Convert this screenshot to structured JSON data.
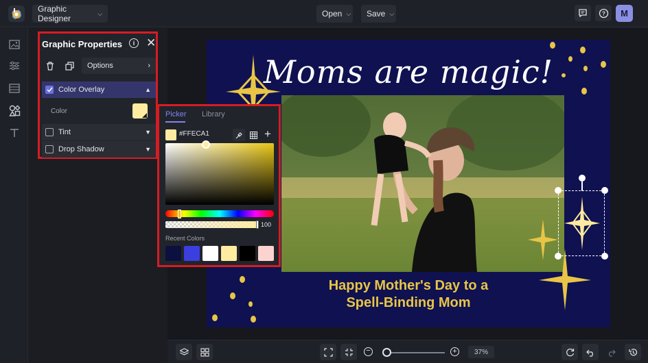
{
  "app": {
    "mode_label": "Graphic Designer",
    "open_label": "Open",
    "save_label": "Save",
    "avatar_initial": "M"
  },
  "properties_panel": {
    "title": "Graphic Properties",
    "options_label": "Options",
    "color_overlay": {
      "label": "Color Overlay",
      "checked": true,
      "color_label": "Color",
      "color_value": "#FFECA1"
    },
    "tint": {
      "label": "Tint",
      "checked": false
    },
    "drop_shadow": {
      "label": "Drop Shadow",
      "checked": false
    }
  },
  "color_picker": {
    "tabs": [
      "Picker",
      "Library"
    ],
    "active_tab": "Picker",
    "hex_value": "#FFECA1",
    "alpha_value": "100",
    "recent_label": "Recent Colors",
    "recent_colors": [
      "#0b1040",
      "#3b3fe0",
      "#ffffff",
      "#ffeca1",
      "#000000",
      "#fcd3cf"
    ]
  },
  "design": {
    "headline": "Moms are magic!",
    "caption_line1": "Happy Mother's Day to a",
    "caption_line2": "Spell-Binding Mom",
    "background_color": "#0f1150",
    "accent_color": "#e8c547"
  },
  "bottom_bar": {
    "zoom_value": "37%"
  },
  "colors": {
    "highlight": "#d61c22",
    "accent": "#6a70e0"
  }
}
